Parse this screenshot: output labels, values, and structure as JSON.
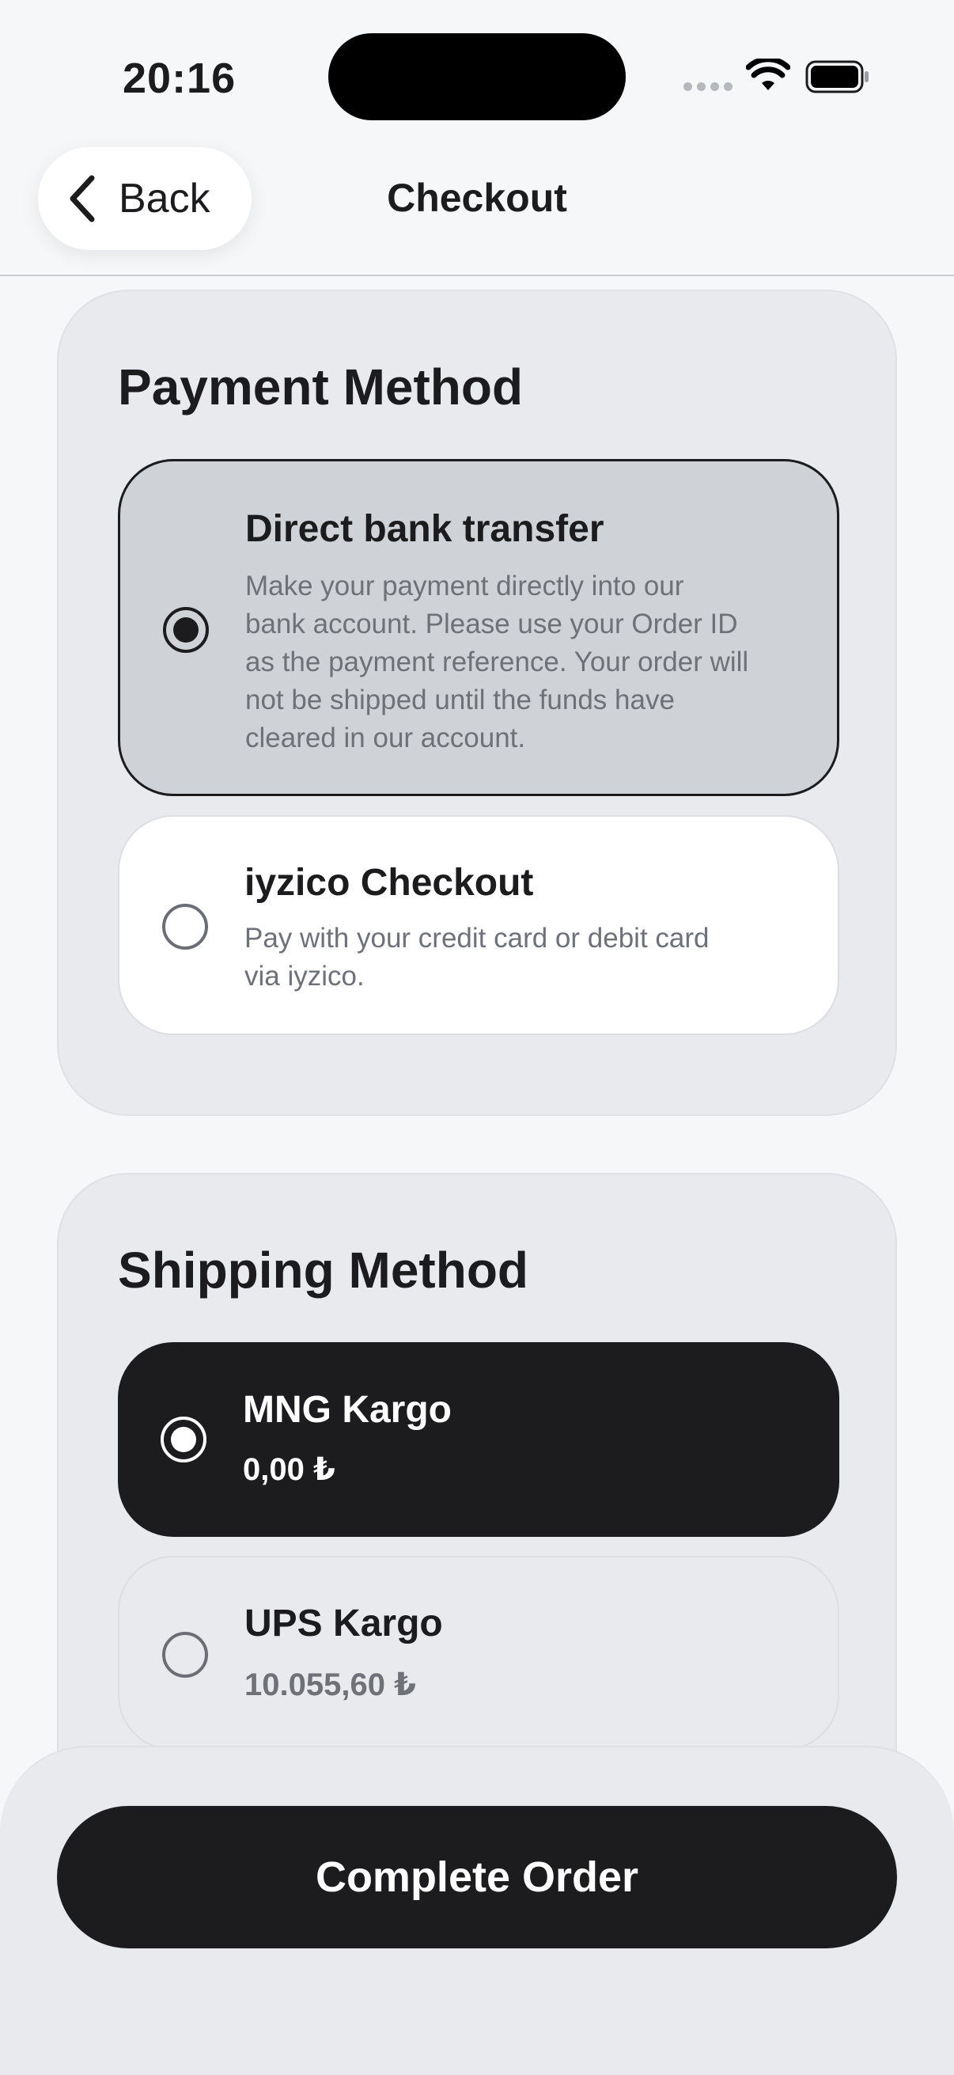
{
  "status_bar": {
    "time": "20:16",
    "icons": [
      "cellular-signal-icon",
      "wifi-icon",
      "battery-icon"
    ]
  },
  "nav": {
    "back_label": "Back",
    "title": "Checkout",
    "back_icon": "chevron-left-icon"
  },
  "payment": {
    "title": "Payment Method",
    "options": [
      {
        "title": "Direct bank transfer",
        "description_lines": [
          "Make your payment directly into our",
          "bank account. Please use your Order ID",
          "as the payment reference. Your order will",
          "not be shipped until the funds have",
          "cleared in our account."
        ],
        "selected": true
      },
      {
        "title": "iyzico Checkout",
        "description_lines": [
          "Pay with your credit card or debit card",
          "via iyzico."
        ],
        "selected": false
      }
    ]
  },
  "shipping": {
    "title": "Shipping Method",
    "options": [
      {
        "title": "MNG Kargo",
        "price": "0,00 ₺",
        "selected": true
      },
      {
        "title": "UPS Kargo",
        "price": "10.055,60 ₺",
        "selected": false
      }
    ]
  },
  "footer": {
    "complete_label": "Complete Order"
  },
  "colors": {
    "background": "#f6f7f9",
    "card": "#e8eaed",
    "selected_payment": "#cfd2d6",
    "dark": "#1c1c1e",
    "muted_text": "#6e7177"
  }
}
